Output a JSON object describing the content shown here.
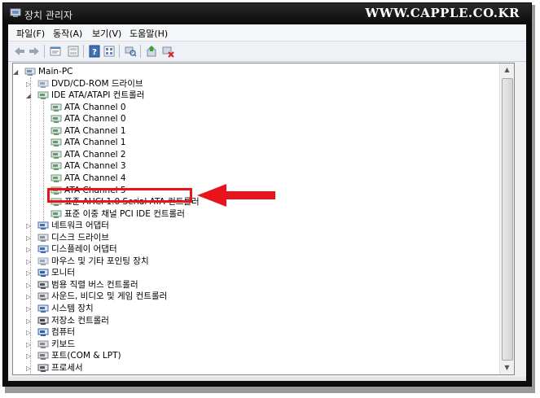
{
  "window": {
    "title": "장치 관리자",
    "watermark": "WWW.CAPPLE.CO.KR"
  },
  "menu": [
    {
      "label": "파일(F)"
    },
    {
      "label": "동작(A)"
    },
    {
      "label": "보기(V)"
    },
    {
      "label": "도움말(H)"
    }
  ],
  "toolbar": {
    "icons": [
      "back-icon",
      "forward-icon",
      "properties-icon",
      "show-hide-icon",
      "help-icon",
      "view-icon",
      "scan-hardware-icon",
      "update-driver-icon",
      "uninstall-icon"
    ]
  },
  "tree": {
    "root": "Main-PC",
    "items": [
      {
        "label": "DVD/CD-ROM 드라이브",
        "level": 1,
        "expanded": false,
        "icon": "dvd-drive-icon"
      },
      {
        "label": "IDE ATA/ATAPI 컨트롤러",
        "level": 1,
        "expanded": true,
        "icon": "ide-controller-icon"
      },
      {
        "label": "ATA Channel 0",
        "level": 2,
        "icon": "ata-channel-icon"
      },
      {
        "label": "ATA Channel 0",
        "level": 2,
        "icon": "ata-channel-icon"
      },
      {
        "label": "ATA Channel 1",
        "level": 2,
        "icon": "ata-channel-icon"
      },
      {
        "label": "ATA Channel 1",
        "level": 2,
        "icon": "ata-channel-icon"
      },
      {
        "label": "ATA Channel 2",
        "level": 2,
        "icon": "ata-channel-icon"
      },
      {
        "label": "ATA Channel 3",
        "level": 2,
        "icon": "ata-channel-icon"
      },
      {
        "label": "ATA Channel 4",
        "level": 2,
        "icon": "ata-channel-icon"
      },
      {
        "label": "ATA Channel 5",
        "level": 2,
        "icon": "ata-channel-icon"
      },
      {
        "label": "표준 AHCI 1.0 Serial ATA 컨트롤러",
        "level": 2,
        "icon": "ahci-controller-icon",
        "highlighted": true
      },
      {
        "label": "표준 이중 채널 PCI IDE 컨트롤러",
        "level": 2,
        "icon": "ide-controller-icon"
      },
      {
        "label": "네트워크 어댑터",
        "level": 1,
        "expanded": false,
        "icon": "network-adapter-icon"
      },
      {
        "label": "디스크 드라이브",
        "level": 1,
        "expanded": false,
        "icon": "disk-drive-icon"
      },
      {
        "label": "디스플레이 어댑터",
        "level": 1,
        "expanded": false,
        "icon": "display-adapter-icon"
      },
      {
        "label": "마우스 및 기타 포인팅 장치",
        "level": 1,
        "expanded": false,
        "icon": "mouse-icon"
      },
      {
        "label": "모니터",
        "level": 1,
        "expanded": false,
        "icon": "monitor-icon"
      },
      {
        "label": "범용 직렬 버스 컨트롤러",
        "level": 1,
        "expanded": false,
        "icon": "usb-icon"
      },
      {
        "label": "사운드, 비디오 및 게임 컨트롤러",
        "level": 1,
        "expanded": false,
        "icon": "sound-icon"
      },
      {
        "label": "시스템 장치",
        "level": 1,
        "expanded": false,
        "icon": "system-device-icon"
      },
      {
        "label": "저장소 컨트롤러",
        "level": 1,
        "expanded": false,
        "icon": "storage-controller-icon"
      },
      {
        "label": "컴퓨터",
        "level": 1,
        "expanded": false,
        "icon": "computer-icon"
      },
      {
        "label": "키보드",
        "level": 1,
        "expanded": false,
        "icon": "keyboard-icon"
      },
      {
        "label": "포트(COM & LPT)",
        "level": 1,
        "expanded": false,
        "icon": "port-icon"
      },
      {
        "label": "프로세서",
        "level": 1,
        "expanded": false,
        "icon": "processor-icon"
      }
    ]
  },
  "annotation": {
    "color": "#e8141c"
  }
}
